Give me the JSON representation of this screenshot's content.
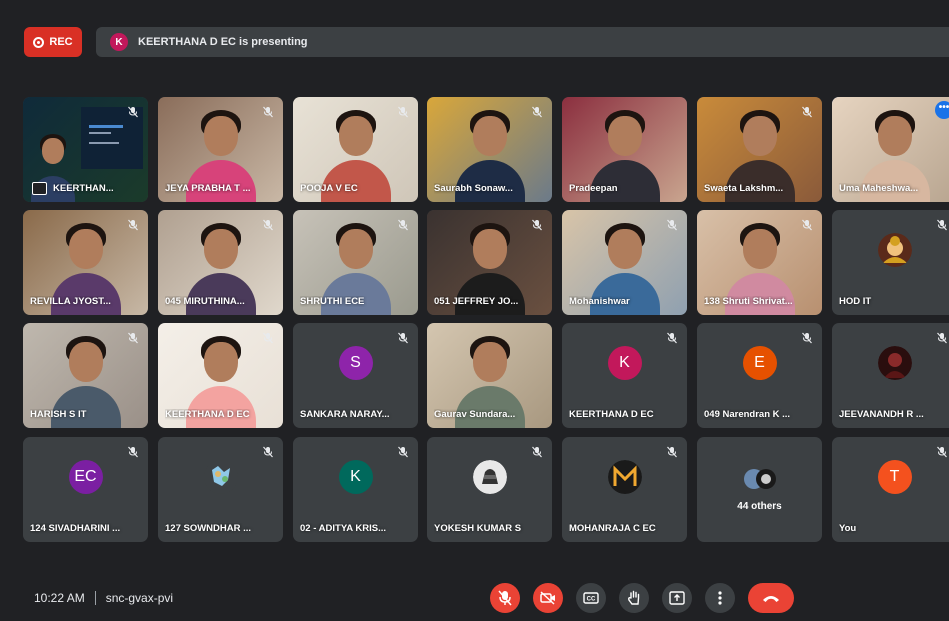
{
  "topbar": {
    "rec_label": "REC",
    "presenter_initial": "K",
    "presenting_text": "KEERTHANA D EC is presenting"
  },
  "colors": {
    "rec": "#d93025",
    "tile_bg": "#3c4043",
    "selected_outline": "#8ab4f8"
  },
  "participants": [
    {
      "name": "KEERTHAN...",
      "kind": "presenting",
      "muted": true
    },
    {
      "name": "JEYA PRABHA T ...",
      "kind": "video",
      "muted": true
    },
    {
      "name": "POOJA V EC",
      "kind": "video",
      "muted": true
    },
    {
      "name": "Saurabh Sonaw...",
      "kind": "video",
      "muted": true
    },
    {
      "name": "Pradeepan",
      "kind": "video",
      "muted": false
    },
    {
      "name": "Swaeta Lakshm...",
      "kind": "video",
      "muted": true
    },
    {
      "name": "Uma Maheshwa...",
      "kind": "video",
      "muted": false,
      "selected": true
    },
    {
      "name": "REVILLA JYOST...",
      "kind": "video",
      "muted": true
    },
    {
      "name": "045 MIRUTHINA...",
      "kind": "video",
      "muted": true
    },
    {
      "name": "SHRUTHI ECE",
      "kind": "video",
      "muted": true
    },
    {
      "name": "051 JEFFREY JO...",
      "kind": "video",
      "muted": true
    },
    {
      "name": "Mohanishwar",
      "kind": "video",
      "muted": true
    },
    {
      "name": "138 Shruti Shrivat...",
      "kind": "video",
      "muted": true
    },
    {
      "name": "HOD IT",
      "kind": "photo",
      "muted": true
    },
    {
      "name": "HARISH S IT",
      "kind": "video",
      "muted": true
    },
    {
      "name": "KEERTHANA D EC",
      "kind": "video",
      "muted": true
    },
    {
      "name": "SANKARA NARAY...",
      "kind": "avatar",
      "initial": "S",
      "color": "#8e24aa",
      "muted": true
    },
    {
      "name": "Gaurav Sundara...",
      "kind": "video",
      "muted": false
    },
    {
      "name": "KEERTHANA D EC",
      "kind": "avatar",
      "initial": "K",
      "color": "#c2185b",
      "muted": true
    },
    {
      "name": "049 Narendran K ...",
      "kind": "avatar",
      "initial": "E",
      "color": "#e65100",
      "muted": true
    },
    {
      "name": "JEEVANANDH R ...",
      "kind": "photo",
      "muted": true
    },
    {
      "name": "124 SIVADHARINI ...",
      "kind": "avatar",
      "initial": "EC",
      "color": "#7b1fa2",
      "muted": true
    },
    {
      "name": "127 SOWNDHAR ...",
      "kind": "photo",
      "muted": true
    },
    {
      "name": "02 - ADITYA KRIS...",
      "kind": "avatar",
      "initial": "K",
      "color": "#00695c",
      "muted": true
    },
    {
      "name": "YOKESH KUMAR S",
      "kind": "photo",
      "muted": true
    },
    {
      "name": "MOHANRAJA C EC",
      "kind": "photo",
      "muted": true
    },
    {
      "name": "44 others",
      "kind": "others",
      "muted": false
    },
    {
      "name": "You",
      "kind": "avatar",
      "initial": "T",
      "color": "#f4511e",
      "muted": true
    }
  ],
  "bottombar": {
    "time": "10:22 AM",
    "meeting_code": "snc-gvax-pvi"
  },
  "controls": [
    {
      "icon": "mic-off-icon",
      "label": "microphone"
    },
    {
      "icon": "camera-off-icon",
      "label": "camera"
    },
    {
      "icon": "captions-icon",
      "label": "captions"
    },
    {
      "icon": "raise-hand-icon",
      "label": "raise hand"
    },
    {
      "icon": "present-icon",
      "label": "present"
    },
    {
      "icon": "more-options-icon",
      "label": "more options"
    },
    {
      "icon": "end-call-icon",
      "label": "leave call"
    }
  ]
}
